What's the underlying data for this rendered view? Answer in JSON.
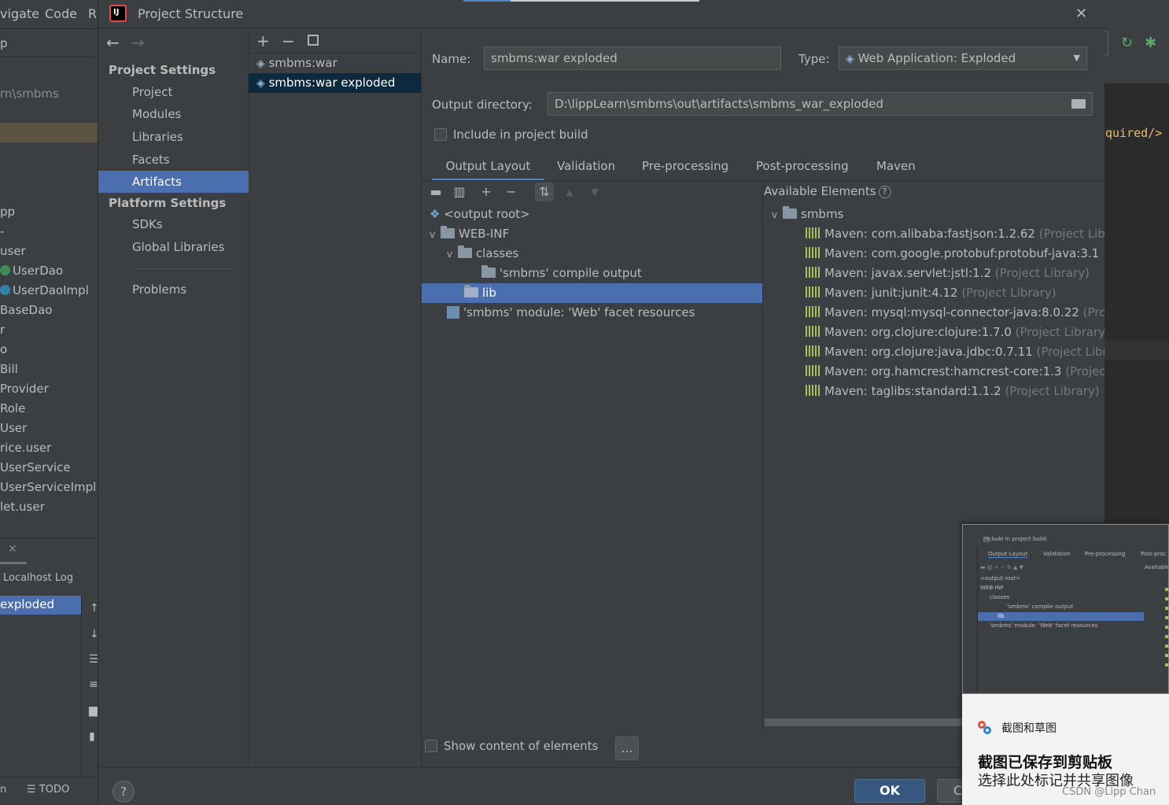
{
  "ide_left": {
    "menu": [
      "vigate",
      "Code",
      "R"
    ],
    "project_label": "p",
    "path_fragment": "rn\\smbms",
    "tree": [
      "pp",
      "-",
      "user",
      "UserDao",
      "UserDaoImpl",
      "BaseDao",
      "r",
      "o",
      "Bill",
      "Provider",
      "Role",
      "User",
      "rice.user",
      "UserService",
      "UserServiceImpl",
      "let.user"
    ],
    "run_tabs": [
      "Localhost Log"
    ],
    "run_item": "exploded",
    "bottom_tabs": [
      "n",
      "TODO"
    ]
  },
  "ide_right": {
    "code_fragment": "quired/>"
  },
  "dialog": {
    "title": "Project Structure",
    "close_glyph": "✕",
    "nav": {
      "project_settings": "Project Settings",
      "items_project": [
        "Project",
        "Modules",
        "Libraries",
        "Facets",
        "Artifacts"
      ],
      "platform_settings": "Platform Settings",
      "items_platform": [
        "SDKs",
        "Global Libraries"
      ],
      "problems": "Problems",
      "selected": "Artifacts"
    },
    "artifacts": [
      "smbms:war",
      "smbms:war exploded"
    ],
    "selected_artifact": "smbms:war exploded",
    "name_label": "Name:",
    "name_value": "smbms:war exploded",
    "type_label": "Type:",
    "type_value": "Web Application: Exploded",
    "output_label": "Output directory:",
    "output_value": "D:\\lippLearn\\smbms\\out\\artifacts\\smbms_war_exploded",
    "include_build": "Include in project build",
    "tabs": [
      "Output Layout",
      "Validation",
      "Pre-processing",
      "Post-processing",
      "Maven"
    ],
    "active_tab": "Output Layout",
    "output_tree": [
      {
        "label": "<output root>"
      },
      {
        "label": "WEB-INF"
      },
      {
        "label": "classes"
      },
      {
        "label": "'smbms' compile output"
      },
      {
        "label": "lib"
      },
      {
        "label": "'smbms' module: 'Web' facet resources"
      }
    ],
    "available_title": "Available Elements",
    "available_root": "smbms",
    "available_items": [
      {
        "name": "Maven: com.alibaba:fastjson:1.2.62",
        "suffix": "(Project Libr"
      },
      {
        "name": "Maven: com.google.protobuf:protobuf-java:3.1",
        "suffix": ""
      },
      {
        "name": "Maven: javax.servlet:jstl:1.2",
        "suffix": "(Project Library)"
      },
      {
        "name": "Maven: junit:junit:4.12",
        "suffix": "(Project Library)"
      },
      {
        "name": "Maven: mysql:mysql-connector-java:8.0.22",
        "suffix": "(Pro"
      },
      {
        "name": "Maven: org.clojure:clojure:1.7.0",
        "suffix": "(Project Library)"
      },
      {
        "name": "Maven: org.clojure:java.jdbc:0.7.11",
        "suffix": "(Project Libr"
      },
      {
        "name": "Maven: org.hamcrest:hamcrest-core:1.3",
        "suffix": "(Projec"
      },
      {
        "name": "Maven: taglibs:standard:1.1.2",
        "suffix": "(Project Library)"
      }
    ],
    "show_content": "Show content of elements",
    "ellipsis": "...",
    "ok": "OK",
    "cancel_fragment": "C",
    "help": "?"
  },
  "snip": {
    "app_name": "截图和草图",
    "title": "截图已保存到剪贴板",
    "subtitle": "选择此处标记并共享图像",
    "watermark": "CSDN @Lipp Chan",
    "thumb": {
      "include": "Include in project build",
      "tabs": [
        "Output Layout",
        "Validation",
        "Pre-processing",
        "Post-proc"
      ],
      "available": "Available",
      "rows": [
        "<output root>",
        "WEB-INF",
        "classes",
        "'smbms' compile output",
        "lib",
        "'smbms' module: 'Web' facet resources"
      ]
    }
  },
  "colors": {
    "selection": "#4b6eaf",
    "dialog_bg": "#3c3f41",
    "editor_bg": "#2b2b2b",
    "accent_tab": "#4a88c7",
    "library_green": "#a5c25c"
  }
}
